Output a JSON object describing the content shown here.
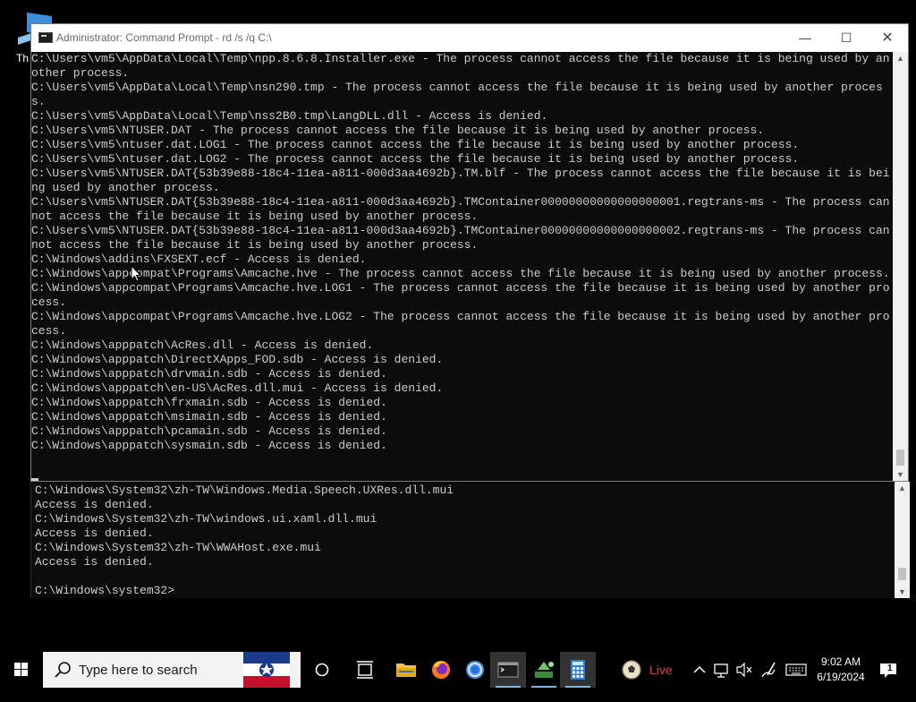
{
  "desktop": {
    "icon_label_partial": "Th"
  },
  "window": {
    "title": "Administrator: Command Prompt - rd  /s /q C:\\",
    "minimize_glyph": "—",
    "maximize_glyph": "☐",
    "close_glyph": "✕",
    "lines": [
      "C:\\Users\\vm5\\AppData\\Local\\Temp\\npp.8.6.8.Installer.exe - The process cannot access the file because it is being used by another process.",
      "C:\\Users\\vm5\\AppData\\Local\\Temp\\nsn290.tmp - The process cannot access the file because it is being used by another process.",
      "C:\\Users\\vm5\\AppData\\Local\\Temp\\nss2B0.tmp\\LangDLL.dll - Access is denied.",
      "C:\\Users\\vm5\\NTUSER.DAT - The process cannot access the file because it is being used by another process.",
      "C:\\Users\\vm5\\ntuser.dat.LOG1 - The process cannot access the file because it is being used by another process.",
      "C:\\Users\\vm5\\ntuser.dat.LOG2 - The process cannot access the file because it is being used by another process.",
      "C:\\Users\\vm5\\NTUSER.DAT{53b39e88-18c4-11ea-a811-000d3aa4692b}.TM.blf - The process cannot access the file because it is being used by another process.",
      "C:\\Users\\vm5\\NTUSER.DAT{53b39e88-18c4-11ea-a811-000d3aa4692b}.TMContainer00000000000000000001.regtrans-ms - The process cannot access the file because it is being used by another process.",
      "C:\\Users\\vm5\\NTUSER.DAT{53b39e88-18c4-11ea-a811-000d3aa4692b}.TMContainer00000000000000000002.regtrans-ms - The process cannot access the file because it is being used by another process.",
      "C:\\Windows\\addins\\FXSEXT.ecf - Access is denied.",
      "C:\\Windows\\appcompat\\Programs\\Amcache.hve - The process cannot access the file because it is being used by another process.",
      "C:\\Windows\\appcompat\\Programs\\Amcache.hve.LOG1 - The process cannot access the file because it is being used by another process.",
      "C:\\Windows\\appcompat\\Programs\\Amcache.hve.LOG2 - The process cannot access the file because it is being used by another process.",
      "C:\\Windows\\apppatch\\AcRes.dll - Access is denied.",
      "C:\\Windows\\apppatch\\DirectXApps_FOD.sdb - Access is denied.",
      "C:\\Windows\\apppatch\\drvmain.sdb - Access is denied.",
      "C:\\Windows\\apppatch\\en-US\\AcRes.dll.mui - Access is denied.",
      "C:\\Windows\\apppatch\\frxmain.sdb - Access is denied.",
      "C:\\Windows\\apppatch\\msimain.sdb - Access is denied.",
      "C:\\Windows\\apppatch\\pcamain.sdb - Access is denied.",
      "C:\\Windows\\apppatch\\sysmain.sdb - Access is denied."
    ]
  },
  "background_console": {
    "lines": [
      "C:\\Windows\\System32\\zh-TW\\Windows.Media.Speech.UXRes.dll.mui",
      "Access is denied.",
      "C:\\Windows\\System32\\zh-TW\\windows.ui.xaml.dll.mui",
      "Access is denied.",
      "C:\\Windows\\System32\\zh-TW\\WWAHost.exe.mui",
      "Access is denied.",
      "",
      "C:\\Windows\\system32>"
    ]
  },
  "taskbar": {
    "search_placeholder": "Type here to search",
    "live_label": "Live",
    "time": "9:02 AM",
    "date": "6/19/2024",
    "notification_count": "1",
    "accent": "#76b9ed"
  }
}
